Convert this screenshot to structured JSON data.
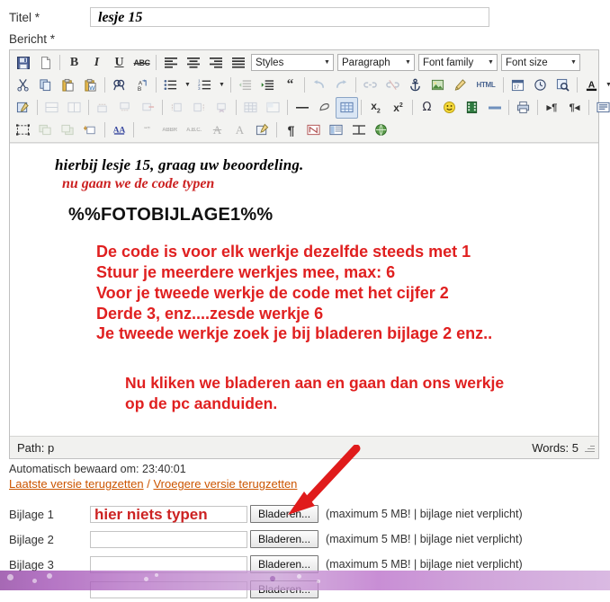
{
  "form": {
    "title_label": "Titel *",
    "title_value": "lesje 15",
    "body_label": "Bericht *"
  },
  "toolbar": {
    "selects": [
      {
        "name": "styles",
        "label": "Styles"
      },
      {
        "name": "paragraph",
        "label": "Paragraph"
      },
      {
        "name": "fontfamily",
        "label": "Font family"
      },
      {
        "name": "fontsize",
        "label": "Font size"
      }
    ],
    "row1_icons": [
      "save-icon",
      "new-document-icon",
      "bold-icon",
      "italic-icon",
      "underline-icon",
      "strikethrough-icon",
      "align-left-icon",
      "align-center-icon",
      "align-right-icon",
      "justify-icon"
    ],
    "row2_icons": [
      "cut-icon",
      "copy-icon",
      "paste-icon",
      "paste-word-icon",
      "find-icon",
      "find-replace-icon",
      "bullet-list-icon",
      "numbered-list-icon",
      "outdent-icon",
      "indent-icon",
      "blockquote-icon",
      "undo-icon",
      "redo-icon",
      "link-icon",
      "unlink-icon",
      "anchor-icon",
      "image-icon",
      "cleanup-icon",
      "html-source-icon",
      "insert-date-icon",
      "insert-time-icon",
      "preview-icon",
      "forecolor-icon",
      "backcolor-icon"
    ],
    "row3_icons": [
      "edit-css-icon",
      "merge-cells-icon",
      "split-cells-icon",
      "row-before-icon",
      "row-after-icon",
      "delete-row-icon",
      "col-before-icon",
      "col-after-icon",
      "delete-col-icon",
      "table-props-icon",
      "cell-props-icon",
      "horizontal-rule-icon",
      "remove-format-icon",
      "visual-aid-icon",
      "subscript-icon",
      "superscript-icon",
      "special-char-icon",
      "emoticon-icon",
      "media-icon",
      "page-break-icon",
      "print-icon",
      "ltr-icon",
      "rtl-icon",
      "fullscreen-icon"
    ],
    "row4_icons": [
      "select-all-icon",
      "layer-back-icon",
      "layer-forward-icon",
      "insert-layer-icon",
      "styleprops-icon",
      "citation-icon",
      "abbreviation-icon",
      "acronym-icon",
      "del-icon",
      "ins-icon",
      "attributes-icon",
      "show-blocks-icon",
      "nonbreaking-icon",
      "template-icon",
      "pagebreak2-icon",
      "xhtml-icon"
    ]
  },
  "content": {
    "script_line_1": "hierbij lesje 15, graag uw beoordeling.",
    "script_line_2": "nu gaan we de code typen",
    "code_placeholder": "%%FOTOBIJLAGE1%%",
    "red_lines": [
      "De code is voor elk werkje dezelfde steeds met 1",
      "Stuur je meerdere werkjes mee, max: 6",
      "Voor je tweede werkje de code met het cijfer 2",
      "Derde 3, enz....zesde werkje 6",
      "Je tweede werkje zoek je bij bladeren bijlage 2 enz.."
    ],
    "red_lines_2": [
      "Nu kliken we bladeren aan en gaan dan ons werkje",
      "op de pc aanduiden."
    ]
  },
  "statusbar": {
    "path_label": "Path: p",
    "words_label": "Words: 5"
  },
  "autosave": {
    "text": "Automatisch bewaard om: 23:40:01",
    "link_last": "Laatste versie terugzetten",
    "separator": "/",
    "link_previous": "Vroegere versie terugzetten"
  },
  "attachments": {
    "browse_label": "Bladeren...",
    "note": "(maximum 5 MB! | bijlage niet verplicht)",
    "rows": [
      {
        "label": "Bijlage 1",
        "value": "hier niets typen"
      },
      {
        "label": "Bijlage 2",
        "value": ""
      },
      {
        "label": "Bijlage 3",
        "value": ""
      },
      {
        "label": "",
        "value": ""
      }
    ]
  },
  "colors": {
    "red_text": "#e02020",
    "script_red": "#cc2222",
    "link": "#cc5500",
    "arrow": "#e01b1b",
    "toolbar_bg": "#f3f3f1"
  }
}
